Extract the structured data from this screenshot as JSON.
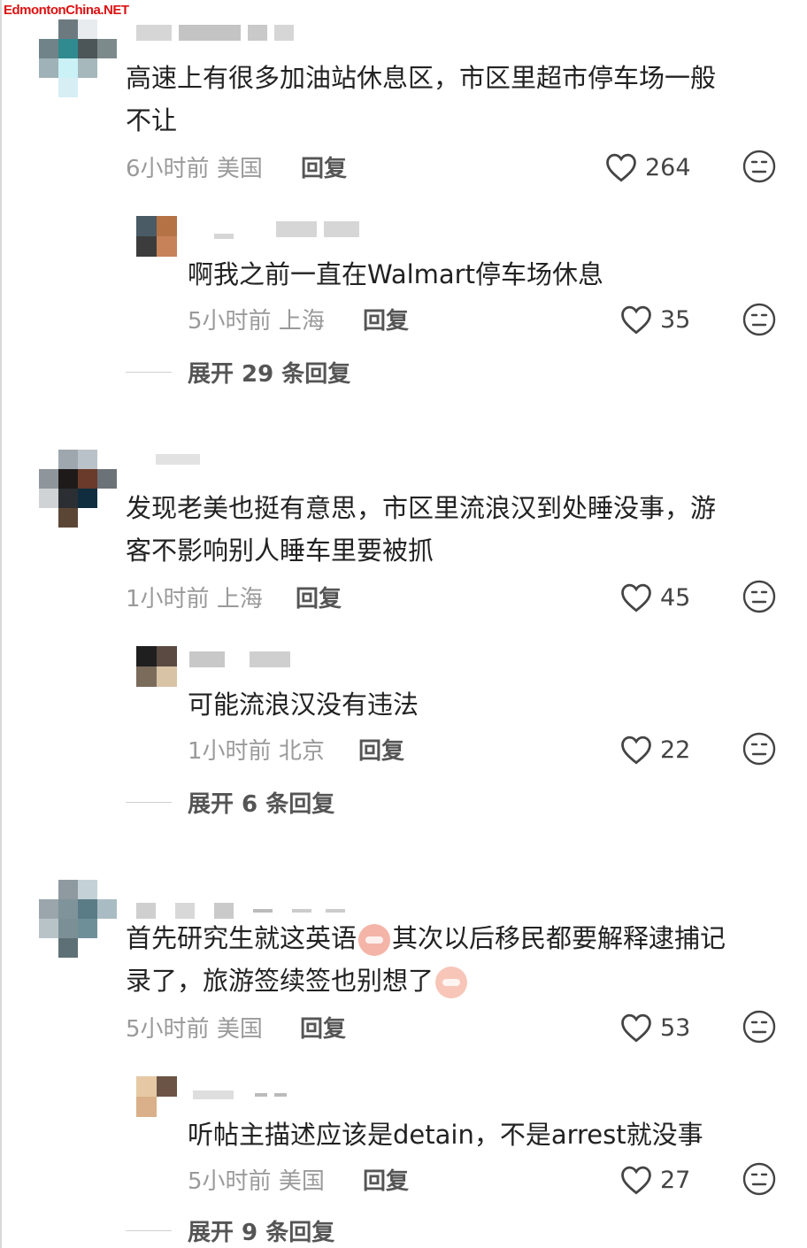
{
  "watermark": "EdmontonChina.NET",
  "comments": [
    {
      "text_lines": [
        "高速上有很多加油站休息区，市区里超市停车场一般",
        "不让"
      ],
      "time": "6小时前",
      "location": "美国",
      "reply_label": "回复",
      "likes": "264",
      "sub_reply": {
        "text_lines": [
          "啊我之前一直在Walmart停车场休息"
        ],
        "time": "5小时前",
        "location": "上海",
        "reply_label": "回复",
        "likes": "35"
      },
      "expand_label": "展开 29 条回复"
    },
    {
      "text_lines": [
        "发现老美也挺有意思，市区里流浪汉到处睡没事，游",
        "客不影响别人睡车里要被抓"
      ],
      "time": "1小时前",
      "location": "上海",
      "reply_label": "回复",
      "likes": "45",
      "sub_reply": {
        "text_lines": [
          "可能流浪汉没有违法"
        ],
        "time": "1小时前",
        "location": "北京",
        "reply_label": "回复",
        "likes": "22"
      },
      "expand_label": "展开 6 条回复"
    },
    {
      "text_lines": [
        "首先研究生就这英语",
        "其次以后移民都要解释逮捕记",
        "录了，旅游签续签也别想了"
      ],
      "time": "5小时前",
      "location": "美国",
      "reply_label": "回复",
      "likes": "53",
      "sub_reply": {
        "text_lines": [
          "听帖主描述应该是detain，不是arrest就没事"
        ],
        "time": "5小时前",
        "location": "美国",
        "reply_label": "回复",
        "likes": "27"
      },
      "expand_label": "展开 9 条回复"
    }
  ],
  "icons": {
    "like": "heart-outline-icon",
    "dislike": "neutral-face-icon",
    "emoji_1": "crying-face-emoji",
    "emoji_2": "sweating-face-emoji"
  }
}
